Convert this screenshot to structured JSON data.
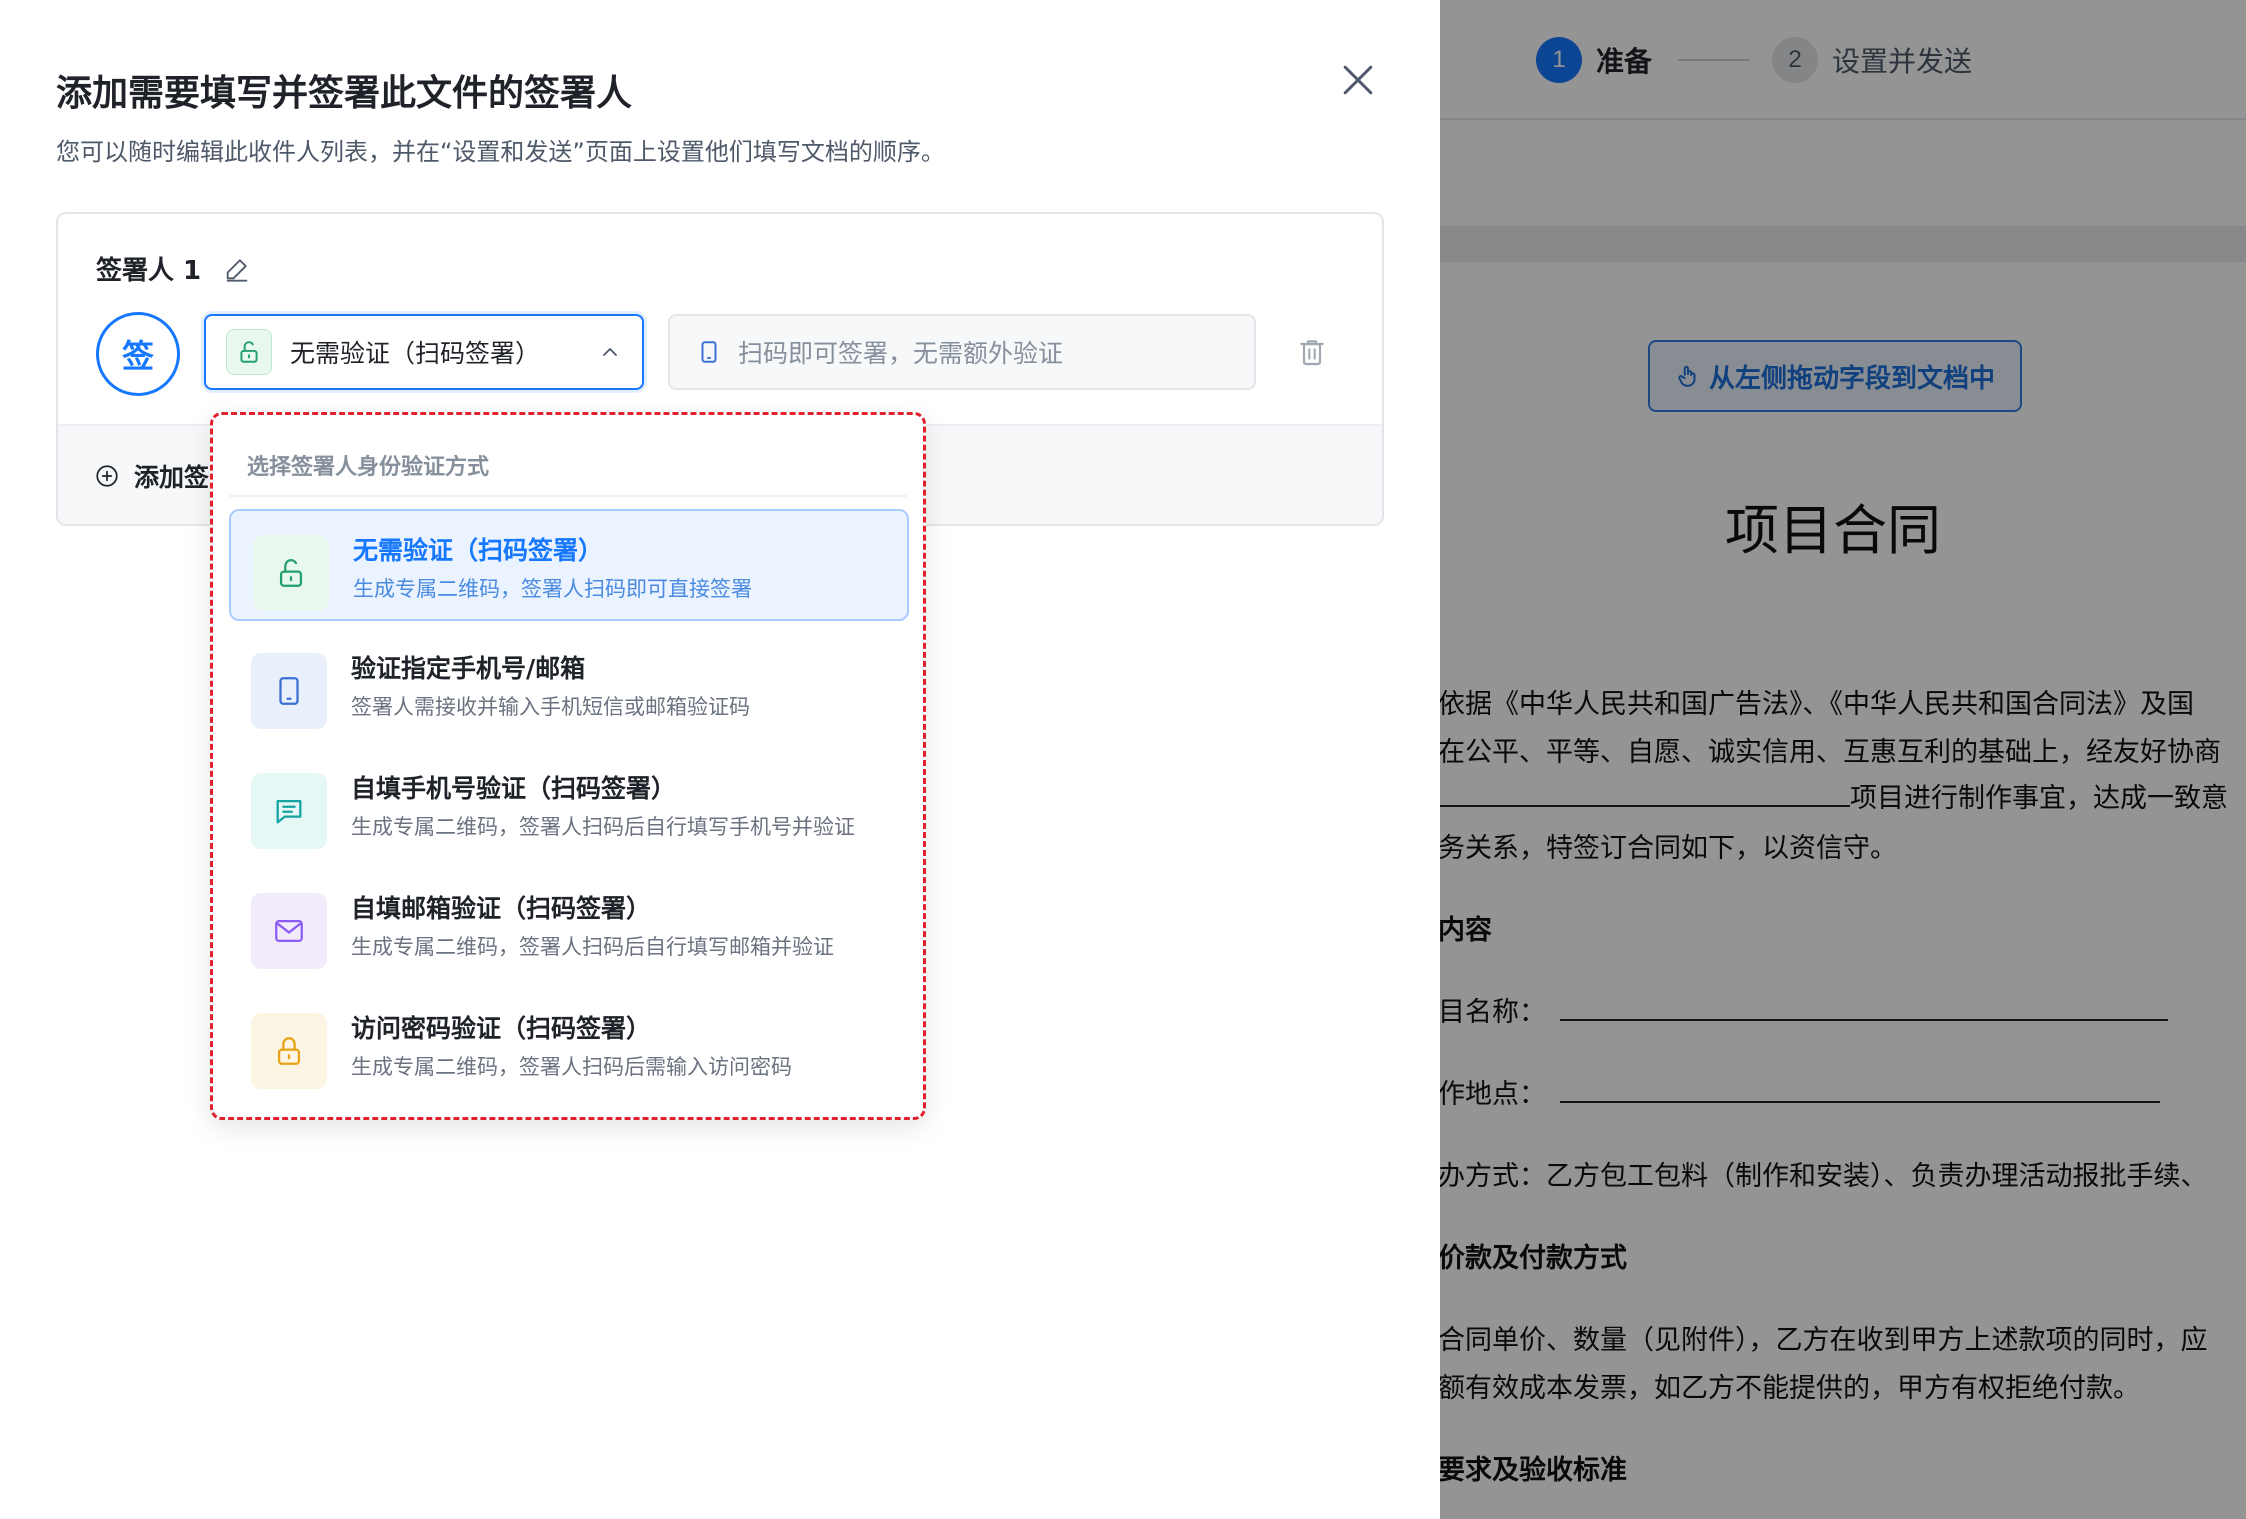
{
  "modal": {
    "title": "添加需要填写并签署此文件的签署人",
    "subtitle": "您可以随时编辑此收件人列表，并在“设置和发送”页面上设置他们填写文档的顺序。"
  },
  "signer": {
    "label": "签署人 1",
    "avatar_char": "签",
    "verify_value": "无需验证（扫码签署）",
    "hint_text": "扫码即可签署，无需额外验证",
    "add_button_label": "添加签"
  },
  "dropdown": {
    "header": "选择签署人身份验证方式",
    "items": [
      {
        "title": "无需验证（扫码签署）",
        "desc": "生成专属二维码，签署人扫码即可直接签署",
        "icon": "unlock-icon",
        "color": "#22a06b",
        "selected": true
      },
      {
        "title": "验证指定手机号/邮箱",
        "desc": "签署人需接收并输入手机短信或邮箱验证码",
        "icon": "phone-icon",
        "color": "#3b6fd4",
        "selected": false
      },
      {
        "title": "自填手机号验证（扫码签署）",
        "desc": "生成专属二维码，签署人扫码后自行填写手机号并验证",
        "icon": "message-icon",
        "color": "#14a3a0",
        "selected": false
      },
      {
        "title": "自填邮箱验证（扫码签署）",
        "desc": "生成专属二维码，签署人扫码后自行填写邮箱并验证",
        "icon": "mail-icon",
        "color": "#8b5cf6",
        "selected": false
      },
      {
        "title": "访问密码验证（扫码签署）",
        "desc": "生成专属二维码，签署人扫码后需输入访问密码",
        "icon": "lock-icon",
        "color": "#e6a317",
        "selected": false
      }
    ]
  },
  "steps": [
    {
      "num": "1",
      "label": "准备",
      "active": true
    },
    {
      "num": "2",
      "label": "设置并发送",
      "active": false
    }
  ],
  "document": {
    "drag_hint": "从左侧拖动字段到文档中",
    "title": "项目合同",
    "lines": [
      "依据《中华人民共和国广告法》、《中华人民共和国合同法》及国",
      "在公平、平等、自愿、诚实信用、互惠互利的基础上，经友好协商",
      "项目进行制作事宜，达成一致意",
      "务关系，特签订合同如下，以资信守。",
      "内容",
      "目名称：",
      "作地点：",
      "办方式：乙方包工包料（制作和安装）、负责办理活动报批手续、",
      "价款及付款方式",
      "合同单价、数量（见附件），乙方在收到甲方上述款项的同时，应",
      "额有效成本发票，如乙方不能提供的，甲方有权拒绝付款。",
      "要求及验收标准"
    ]
  },
  "colors": {
    "primary": "#1677ff",
    "highlight_border": "#e0202c"
  }
}
